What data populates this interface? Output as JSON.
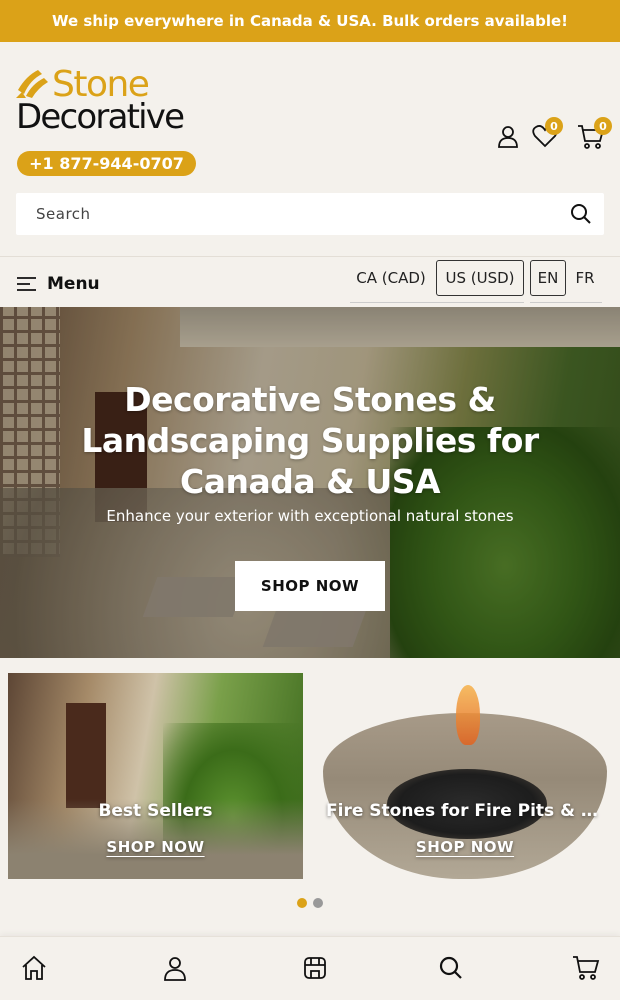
{
  "announcement": "We ship everywhere in Canada & USA. Bulk orders available!",
  "logo": {
    "line1": "Stone",
    "line2": "Decorative",
    "brand_color": "#dba218"
  },
  "phone": "+1 877-944-0707",
  "header": {
    "account_icon": "user-icon",
    "wishlist_icon": "heart-icon",
    "wishlist_count": "0",
    "cart_icon": "cart-icon",
    "cart_count": "0"
  },
  "search": {
    "placeholder": "Search",
    "value": "",
    "icon": "search-icon"
  },
  "menu": {
    "label": "Menu",
    "icon": "hamburger-icon"
  },
  "currency": {
    "options": [
      "CA (CAD)",
      "US (USD)"
    ],
    "selected": "US (USD)"
  },
  "language": {
    "options": [
      "EN",
      "FR"
    ],
    "selected": "EN"
  },
  "hero": {
    "title": "Decorative Stones & Landscaping Supplies for Canada & USA",
    "subtitle": "Enhance your exterior with exceptional natural stones",
    "cta": "SHOP NOW"
  },
  "cards": [
    {
      "title": "Best Sellers",
      "link": "SHOP NOW"
    },
    {
      "title": "Fire Stones for Fire Pits & Fir...",
      "link": "SHOP NOW"
    }
  ],
  "carousel": {
    "total": 2,
    "active": 1,
    "active_color": "#dba218",
    "inactive_color": "#999999"
  },
  "bottom_nav": [
    "home-icon",
    "account-icon",
    "store-icon",
    "search-icon",
    "cart-icon"
  ]
}
